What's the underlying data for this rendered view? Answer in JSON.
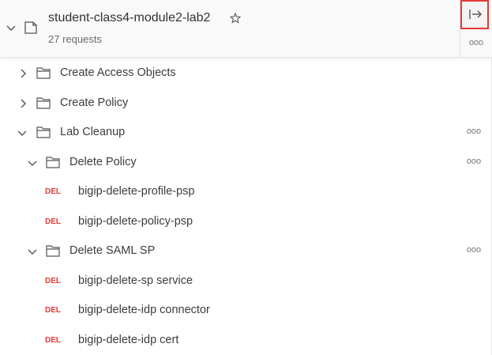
{
  "collection": {
    "title": "student-class4-module2-lab2",
    "request_count": "27 requests"
  },
  "header": {
    "expand_icon": "arrow-right-to-bar-icon",
    "more_icon": "ellipsis-icon",
    "accent_color": "#e53935"
  },
  "tree": {
    "folders_top": [
      {
        "label": "Create Access Objects",
        "expanded": false
      },
      {
        "label": "Create Policy",
        "expanded": false
      },
      {
        "label": "Lab Cleanup",
        "expanded": true
      }
    ],
    "delete_policy": {
      "label": "Delete Policy",
      "requests": [
        {
          "method": "DEL",
          "label": "bigip-delete-profile-psp"
        },
        {
          "method": "DEL",
          "label": "bigip-delete-policy-psp"
        }
      ]
    },
    "delete_saml_sp": {
      "label": "Delete SAML SP",
      "requests": [
        {
          "method": "DEL",
          "label": "bigip-delete-sp service"
        },
        {
          "method": "DEL",
          "label": "bigip-delete-idp connector"
        },
        {
          "method": "DEL",
          "label": "bigip-delete-idp cert"
        }
      ]
    },
    "more_label": "ooo"
  }
}
